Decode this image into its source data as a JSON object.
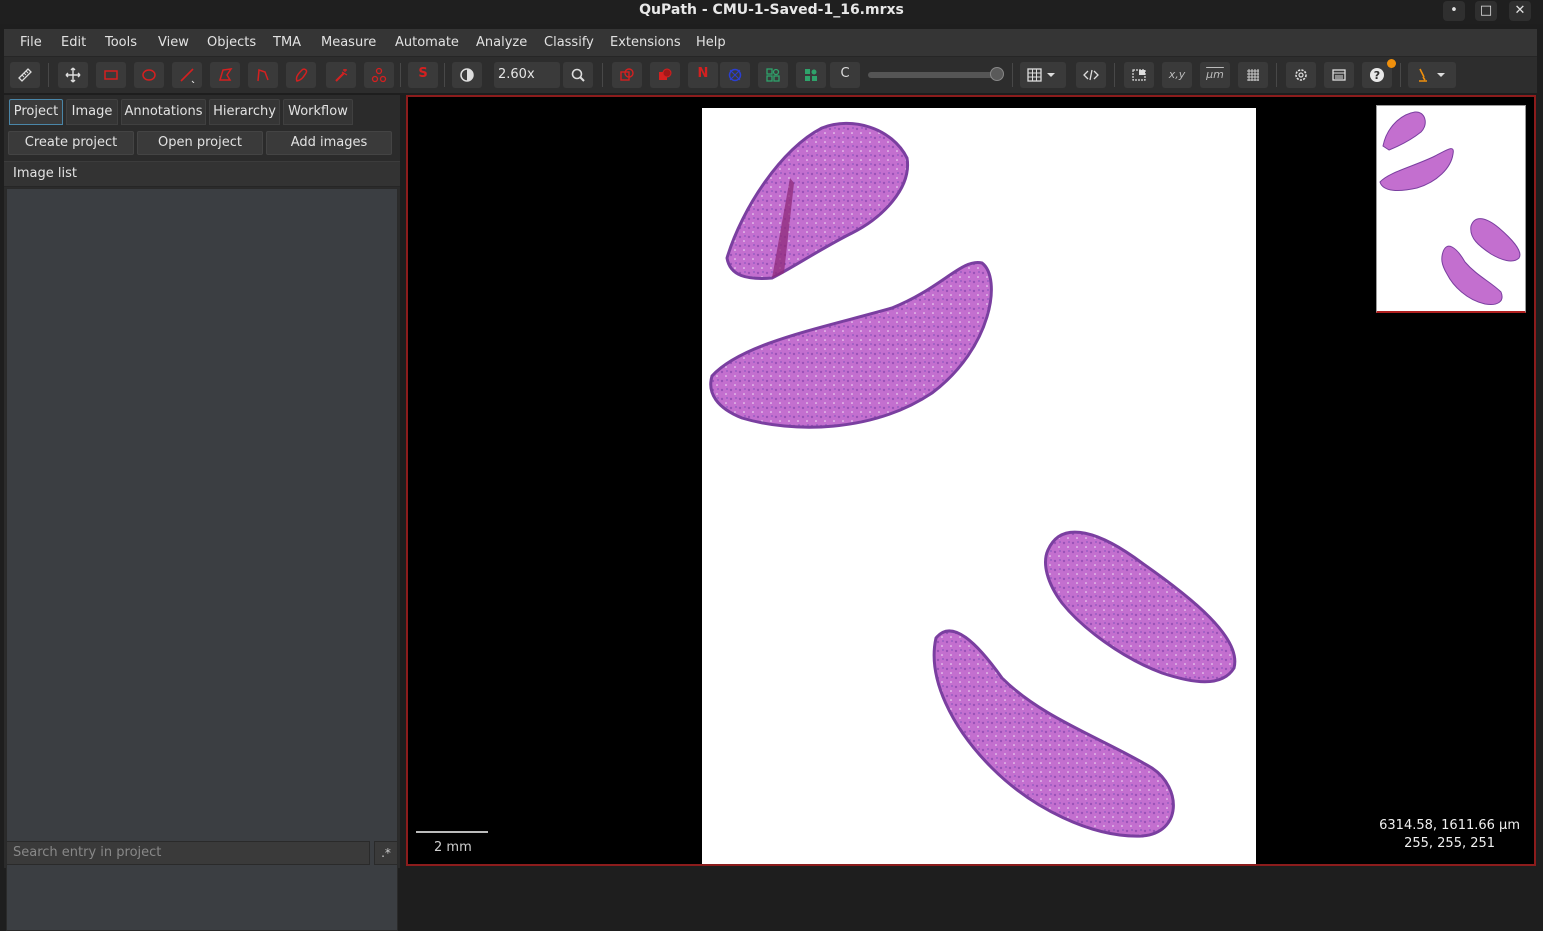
{
  "window": {
    "title": "QuPath - CMU-1-Saved-1_16.mrxs",
    "minimize": "•",
    "maximize": "□",
    "close": "✕"
  },
  "menu": [
    "File",
    "Edit",
    "Tools",
    "View",
    "Objects",
    "TMA",
    "Measure",
    "Automate",
    "Analyze",
    "Classify",
    "Extensions",
    "Help"
  ],
  "toolbar": {
    "zoom": "2.60x",
    "selection_mode": "S",
    "nucleus": "N",
    "cells": "C",
    "coords_label": "x,y",
    "scale_label": "μm"
  },
  "colors": {
    "accent_red": "#d42020",
    "accent_green": "#2fa36b",
    "accent_blue": "#2b3fd0",
    "viewer_border": "#8c1c1c",
    "tissue": "#b45bc2"
  },
  "left_panel": {
    "tabs": [
      "Project",
      "Image",
      "Annotations",
      "Hierarchy",
      "Workflow"
    ],
    "active_tab": "Project",
    "buttons": {
      "create": "Create project",
      "open": "Open project",
      "add": "Add images"
    },
    "image_list_header": "Image list",
    "search_placeholder": "Search entry in project",
    "regex_toggle": ".*"
  },
  "viewer": {
    "scale_bar": "2 mm",
    "cursor_position": "6314.58, 1611.66 μm",
    "pixel_value": "255, 255, 251"
  }
}
